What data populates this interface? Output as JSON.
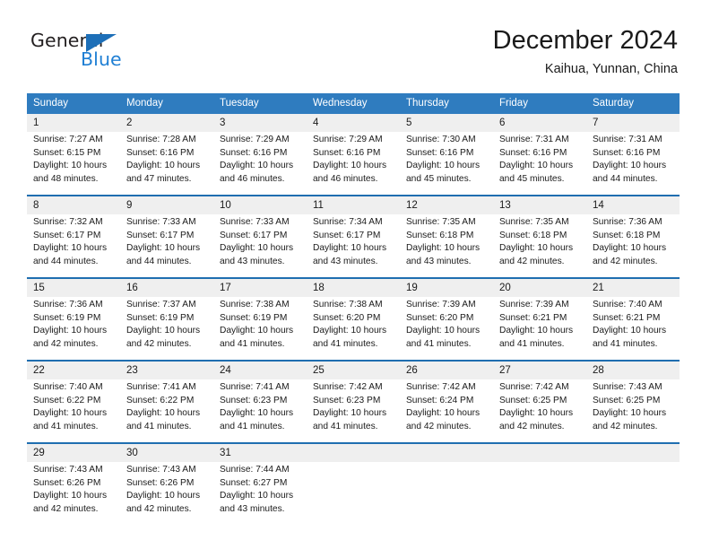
{
  "brand": {
    "name_part1": "General",
    "name_part2": "Blue",
    "triangle_icon": "triangle-icon",
    "color_dark": "#231f20",
    "color_blue": "#1f7fd4"
  },
  "header": {
    "month_title": "December 2024",
    "location": "Kaihua, Yunnan, China"
  },
  "theme": {
    "header_blue": "#2f7cbf",
    "rule_blue": "#1f6eb0",
    "daynum_band": "#efefef",
    "cell_background": "#ffffff",
    "text": "#1a1a1a"
  },
  "weekdays": [
    "Sunday",
    "Monday",
    "Tuesday",
    "Wednesday",
    "Thursday",
    "Friday",
    "Saturday"
  ],
  "weeks": [
    {
      "days": [
        {
          "num": "1",
          "sunrise": "Sunrise: 7:27 AM",
          "sunset": "Sunset: 6:15 PM",
          "daylight_line1": "Daylight: 10 hours",
          "daylight_line2": "and 48 minutes."
        },
        {
          "num": "2",
          "sunrise": "Sunrise: 7:28 AM",
          "sunset": "Sunset: 6:16 PM",
          "daylight_line1": "Daylight: 10 hours",
          "daylight_line2": "and 47 minutes."
        },
        {
          "num": "3",
          "sunrise": "Sunrise: 7:29 AM",
          "sunset": "Sunset: 6:16 PM",
          "daylight_line1": "Daylight: 10 hours",
          "daylight_line2": "and 46 minutes."
        },
        {
          "num": "4",
          "sunrise": "Sunrise: 7:29 AM",
          "sunset": "Sunset: 6:16 PM",
          "daylight_line1": "Daylight: 10 hours",
          "daylight_line2": "and 46 minutes."
        },
        {
          "num": "5",
          "sunrise": "Sunrise: 7:30 AM",
          "sunset": "Sunset: 6:16 PM",
          "daylight_line1": "Daylight: 10 hours",
          "daylight_line2": "and 45 minutes."
        },
        {
          "num": "6",
          "sunrise": "Sunrise: 7:31 AM",
          "sunset": "Sunset: 6:16 PM",
          "daylight_line1": "Daylight: 10 hours",
          "daylight_line2": "and 45 minutes."
        },
        {
          "num": "7",
          "sunrise": "Sunrise: 7:31 AM",
          "sunset": "Sunset: 6:16 PM",
          "daylight_line1": "Daylight: 10 hours",
          "daylight_line2": "and 44 minutes."
        }
      ]
    },
    {
      "days": [
        {
          "num": "8",
          "sunrise": "Sunrise: 7:32 AM",
          "sunset": "Sunset: 6:17 PM",
          "daylight_line1": "Daylight: 10 hours",
          "daylight_line2": "and 44 minutes."
        },
        {
          "num": "9",
          "sunrise": "Sunrise: 7:33 AM",
          "sunset": "Sunset: 6:17 PM",
          "daylight_line1": "Daylight: 10 hours",
          "daylight_line2": "and 44 minutes."
        },
        {
          "num": "10",
          "sunrise": "Sunrise: 7:33 AM",
          "sunset": "Sunset: 6:17 PM",
          "daylight_line1": "Daylight: 10 hours",
          "daylight_line2": "and 43 minutes."
        },
        {
          "num": "11",
          "sunrise": "Sunrise: 7:34 AM",
          "sunset": "Sunset: 6:17 PM",
          "daylight_line1": "Daylight: 10 hours",
          "daylight_line2": "and 43 minutes."
        },
        {
          "num": "12",
          "sunrise": "Sunrise: 7:35 AM",
          "sunset": "Sunset: 6:18 PM",
          "daylight_line1": "Daylight: 10 hours",
          "daylight_line2": "and 43 minutes."
        },
        {
          "num": "13",
          "sunrise": "Sunrise: 7:35 AM",
          "sunset": "Sunset: 6:18 PM",
          "daylight_line1": "Daylight: 10 hours",
          "daylight_line2": "and 42 minutes."
        },
        {
          "num": "14",
          "sunrise": "Sunrise: 7:36 AM",
          "sunset": "Sunset: 6:18 PM",
          "daylight_line1": "Daylight: 10 hours",
          "daylight_line2": "and 42 minutes."
        }
      ]
    },
    {
      "days": [
        {
          "num": "15",
          "sunrise": "Sunrise: 7:36 AM",
          "sunset": "Sunset: 6:19 PM",
          "daylight_line1": "Daylight: 10 hours",
          "daylight_line2": "and 42 minutes."
        },
        {
          "num": "16",
          "sunrise": "Sunrise: 7:37 AM",
          "sunset": "Sunset: 6:19 PM",
          "daylight_line1": "Daylight: 10 hours",
          "daylight_line2": "and 42 minutes."
        },
        {
          "num": "17",
          "sunrise": "Sunrise: 7:38 AM",
          "sunset": "Sunset: 6:19 PM",
          "daylight_line1": "Daylight: 10 hours",
          "daylight_line2": "and 41 minutes."
        },
        {
          "num": "18",
          "sunrise": "Sunrise: 7:38 AM",
          "sunset": "Sunset: 6:20 PM",
          "daylight_line1": "Daylight: 10 hours",
          "daylight_line2": "and 41 minutes."
        },
        {
          "num": "19",
          "sunrise": "Sunrise: 7:39 AM",
          "sunset": "Sunset: 6:20 PM",
          "daylight_line1": "Daylight: 10 hours",
          "daylight_line2": "and 41 minutes."
        },
        {
          "num": "20",
          "sunrise": "Sunrise: 7:39 AM",
          "sunset": "Sunset: 6:21 PM",
          "daylight_line1": "Daylight: 10 hours",
          "daylight_line2": "and 41 minutes."
        },
        {
          "num": "21",
          "sunrise": "Sunrise: 7:40 AM",
          "sunset": "Sunset: 6:21 PM",
          "daylight_line1": "Daylight: 10 hours",
          "daylight_line2": "and 41 minutes."
        }
      ]
    },
    {
      "days": [
        {
          "num": "22",
          "sunrise": "Sunrise: 7:40 AM",
          "sunset": "Sunset: 6:22 PM",
          "daylight_line1": "Daylight: 10 hours",
          "daylight_line2": "and 41 minutes."
        },
        {
          "num": "23",
          "sunrise": "Sunrise: 7:41 AM",
          "sunset": "Sunset: 6:22 PM",
          "daylight_line1": "Daylight: 10 hours",
          "daylight_line2": "and 41 minutes."
        },
        {
          "num": "24",
          "sunrise": "Sunrise: 7:41 AM",
          "sunset": "Sunset: 6:23 PM",
          "daylight_line1": "Daylight: 10 hours",
          "daylight_line2": "and 41 minutes."
        },
        {
          "num": "25",
          "sunrise": "Sunrise: 7:42 AM",
          "sunset": "Sunset: 6:23 PM",
          "daylight_line1": "Daylight: 10 hours",
          "daylight_line2": "and 41 minutes."
        },
        {
          "num": "26",
          "sunrise": "Sunrise: 7:42 AM",
          "sunset": "Sunset: 6:24 PM",
          "daylight_line1": "Daylight: 10 hours",
          "daylight_line2": "and 42 minutes."
        },
        {
          "num": "27",
          "sunrise": "Sunrise: 7:42 AM",
          "sunset": "Sunset: 6:25 PM",
          "daylight_line1": "Daylight: 10 hours",
          "daylight_line2": "and 42 minutes."
        },
        {
          "num": "28",
          "sunrise": "Sunrise: 7:43 AM",
          "sunset": "Sunset: 6:25 PM",
          "daylight_line1": "Daylight: 10 hours",
          "daylight_line2": "and 42 minutes."
        }
      ]
    },
    {
      "days": [
        {
          "num": "29",
          "sunrise": "Sunrise: 7:43 AM",
          "sunset": "Sunset: 6:26 PM",
          "daylight_line1": "Daylight: 10 hours",
          "daylight_line2": "and 42 minutes."
        },
        {
          "num": "30",
          "sunrise": "Sunrise: 7:43 AM",
          "sunset": "Sunset: 6:26 PM",
          "daylight_line1": "Daylight: 10 hours",
          "daylight_line2": "and 42 minutes."
        },
        {
          "num": "31",
          "sunrise": "Sunrise: 7:44 AM",
          "sunset": "Sunset: 6:27 PM",
          "daylight_line1": "Daylight: 10 hours",
          "daylight_line2": "and 43 minutes."
        },
        {
          "num": "",
          "sunrise": "",
          "sunset": "",
          "daylight_line1": "",
          "daylight_line2": ""
        },
        {
          "num": "",
          "sunrise": "",
          "sunset": "",
          "daylight_line1": "",
          "daylight_line2": ""
        },
        {
          "num": "",
          "sunrise": "",
          "sunset": "",
          "daylight_line1": "",
          "daylight_line2": ""
        },
        {
          "num": "",
          "sunrise": "",
          "sunset": "",
          "daylight_line1": "",
          "daylight_line2": ""
        }
      ]
    }
  ]
}
